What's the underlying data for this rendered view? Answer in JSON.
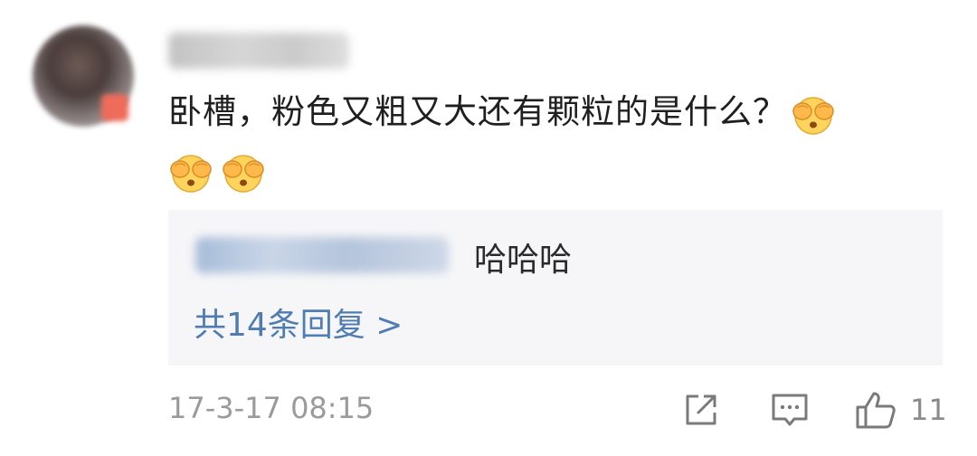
{
  "comment": {
    "text": "卧槽，粉色又粗又大还有颗粒的是什么？",
    "emoji_icon": "see-no-evil-face-emoji",
    "timestamp": "17-3-17 08:15",
    "like_count": "11"
  },
  "reply": {
    "text": "哈哈哈",
    "count_label": "共14条回复 >"
  },
  "actions": {
    "share_icon": "share-icon",
    "comment_icon": "comment-icon",
    "like_icon": "thumbs-up-icon"
  },
  "colors": {
    "link": "#4f7db3",
    "reply_bg": "#f6f6f8",
    "meta_text": "#9a9a9a"
  }
}
